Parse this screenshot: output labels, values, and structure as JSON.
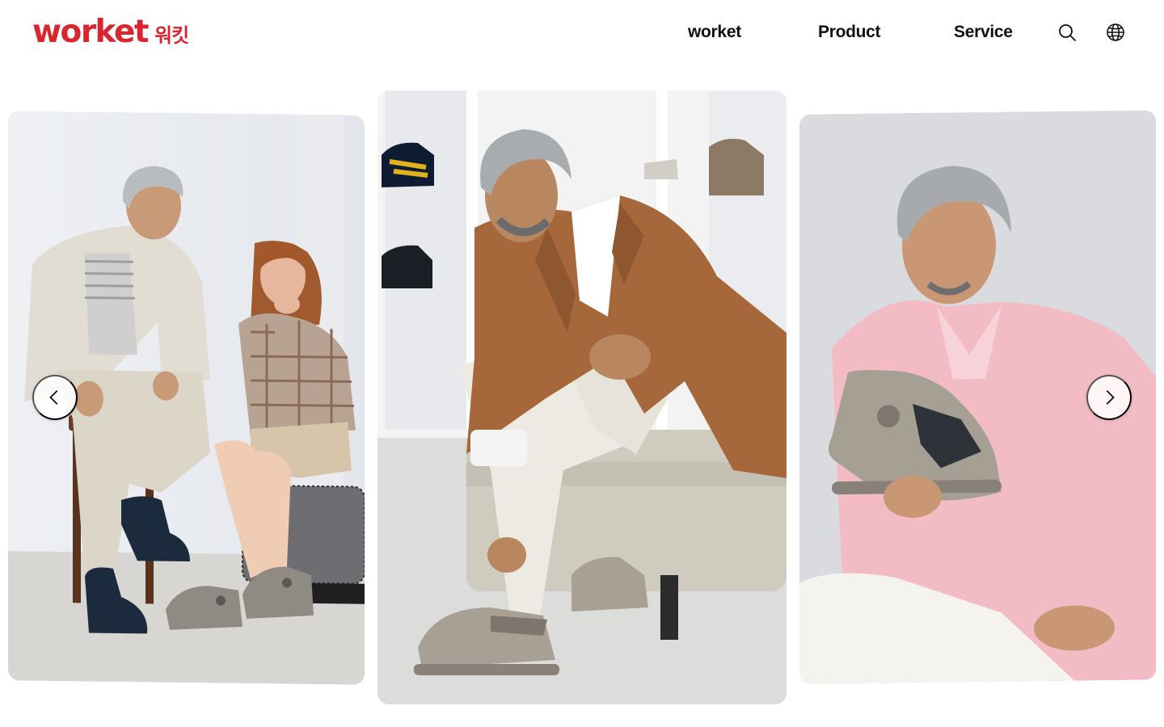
{
  "brand": {
    "name": "worket",
    "name_ko": "워킷",
    "color": "#d9262e"
  },
  "nav": [
    {
      "label": "worket"
    },
    {
      "label": "Product"
    },
    {
      "label": "Service"
    }
  ],
  "header_icons": [
    "search-icon",
    "globe-icon"
  ],
  "carousel": {
    "slides": [
      {
        "scene": "couple-seated-wearing-worket-shoes"
      },
      {
        "scene": "man-in-brown-blazer-tying-shoe"
      },
      {
        "scene": "man-in-pink-shirt-holding-boot"
      }
    ],
    "prev_icon": "chevron-left-icon",
    "next_icon": "chevron-right-icon"
  }
}
